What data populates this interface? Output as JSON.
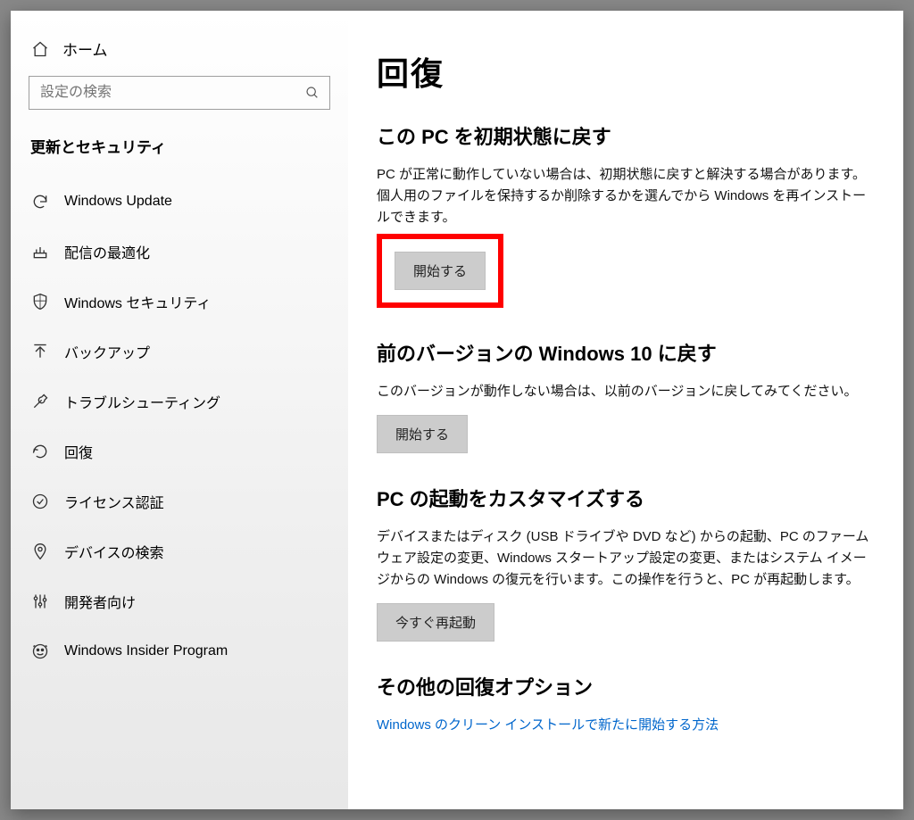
{
  "sidebar": {
    "home_label": "ホーム",
    "search_placeholder": "設定の検索",
    "category_title": "更新とセキュリティ",
    "items": [
      {
        "label": "Windows Update"
      },
      {
        "label": "配信の最適化"
      },
      {
        "label": "Windows セキュリティ"
      },
      {
        "label": "バックアップ"
      },
      {
        "label": "トラブルシューティング"
      },
      {
        "label": "回復"
      },
      {
        "label": "ライセンス認証"
      },
      {
        "label": "デバイスの検索"
      },
      {
        "label": "開発者向け"
      },
      {
        "label": "Windows Insider Program"
      }
    ]
  },
  "main": {
    "page_title": "回復",
    "reset": {
      "title": "この PC を初期状態に戻す",
      "desc": "PC が正常に動作していない場合は、初期状態に戻すと解決する場合があります。個人用のファイルを保持するか削除するかを選んでから Windows を再インストールできます。",
      "button": "開始する"
    },
    "goBack": {
      "title": "前のバージョンの Windows 10 に戻す",
      "desc": "このバージョンが動作しない場合は、以前のバージョンに戻してみてください。",
      "button": "開始する"
    },
    "advanced": {
      "title": "PC の起動をカスタマイズする",
      "desc": "デバイスまたはディスク (USB ドライブや DVD など) からの起動、PC のファームウェア設定の変更、Windows スタートアップ設定の変更、またはシステム イメージからの Windows の復元を行います。この操作を行うと、PC が再起動します。",
      "button": "今すぐ再起動"
    },
    "more": {
      "title": "その他の回復オプション",
      "link": "Windows のクリーン インストールで新たに開始する方法"
    }
  }
}
